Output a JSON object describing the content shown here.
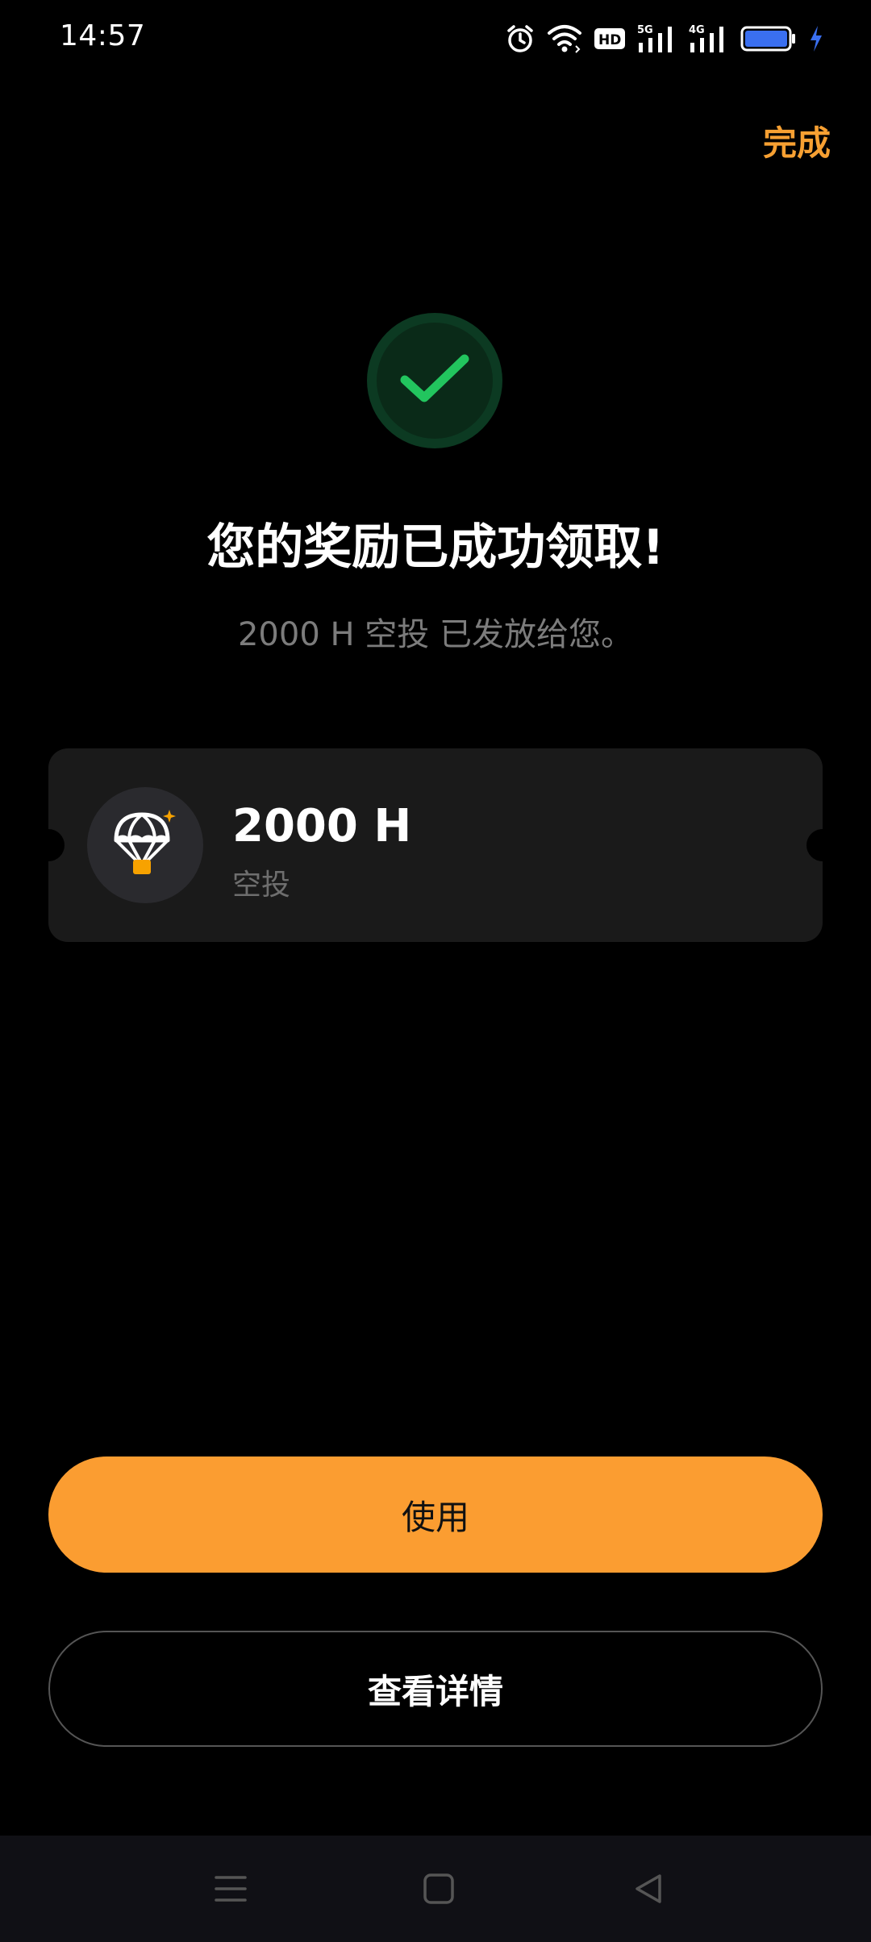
{
  "status_bar": {
    "time": "14:57",
    "network_5g": "5G",
    "network_4g": "4G",
    "hd_label": "HD"
  },
  "header": {
    "done_label": "完成"
  },
  "success": {
    "title": "您的奖励已成功领取!",
    "subtitle": "2000 H 空投 已发放给您。"
  },
  "reward": {
    "amount": "2000 H",
    "type": "空投",
    "icon": "parachute-icon"
  },
  "actions": {
    "use_label": "使用",
    "details_label": "查看详情"
  },
  "colors": {
    "accent": "#fb9d31",
    "success_green": "#22c55e",
    "background": "#000000",
    "card": "#1a1a1a"
  },
  "nav": {
    "icons": [
      "menu-icon",
      "home-icon",
      "back-icon"
    ]
  }
}
